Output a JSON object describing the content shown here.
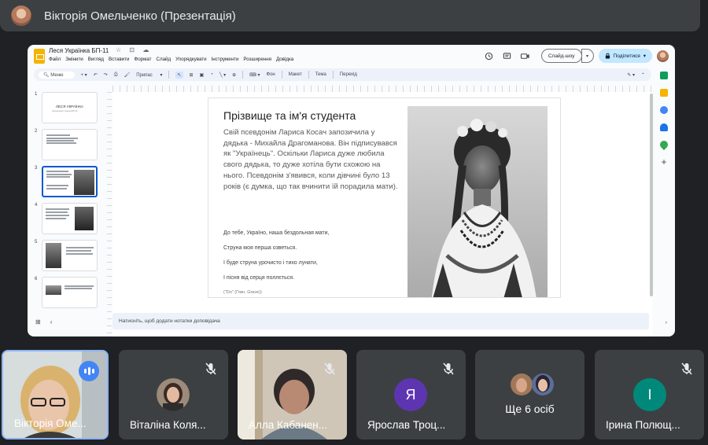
{
  "presenter": {
    "title": "Вікторія Омельченко (Презентація)"
  },
  "slides_app": {
    "doc_title": "Леся Українка БП-11",
    "doc_title_icons": "☆ ⊡ ☁",
    "menu": [
      "Файл",
      "Змінити",
      "Вигляд",
      "Вставити",
      "Формат",
      "Слайд",
      "Упорядкувати",
      "Інструменти",
      "Розширення",
      "Довідка"
    ],
    "slideshow_label": "Слайд-шоу",
    "share_label": "Поділитися",
    "toolbar": {
      "menu_search": "Меню",
      "zoom_label": "Припас",
      "bg_label": "Фон",
      "layout_label": "Макет",
      "theme_label": "Тема",
      "transition_label": "Перехід"
    },
    "thumbnails": [
      {
        "num": "1",
        "title": "ЛЕСЯ УКРАЇНКА",
        "subtitle": "презентація студента БП-11"
      },
      {
        "num": "2"
      },
      {
        "num": "3"
      },
      {
        "num": "4"
      },
      {
        "num": "5"
      },
      {
        "num": "6"
      }
    ],
    "notes_placeholder": "Натисніть, щоб додати нотатки доповідача"
  },
  "slide": {
    "title": "Прізвище та ім'я студента",
    "body": "Свій псевдонім Лариса Косач запозичила у дядька - Михайла Драгоманова. Він підписувався як \"Українець\". Оскільки Лариса дуже любила свого дядька, то дуже хотіла бути схожою на нього. Псевдонім з'явився, коли дівчині було 13 років (є думка, що так вчинити їй порадила мати).",
    "poem": [
      "До тебе, Україно, наша бездольная мати,",
      "Струна моя перша озветься.",
      "І буде струна урочисто і тихо лунати,",
      "І пісня від серця поллється."
    ],
    "poem_source": "(\"Do\" (Гімн. Grave))"
  },
  "participants": [
    {
      "name": "Вікторія Оме...",
      "speaking": true
    },
    {
      "name": "Віталіна Коля..."
    },
    {
      "name": "Алла Кабанен..."
    },
    {
      "name": "Ярослав Троц...",
      "initial": "Я",
      "color": "#5e35b1"
    },
    {
      "name": "Ще 6 осіб"
    },
    {
      "name": "Ірина Полющ...",
      "initial": "І",
      "color": "#00897b"
    }
  ],
  "colors": {
    "accent": "#8ab4f8",
    "share_btn": "#c2e7ff",
    "tile_bg": "#3c4043"
  }
}
